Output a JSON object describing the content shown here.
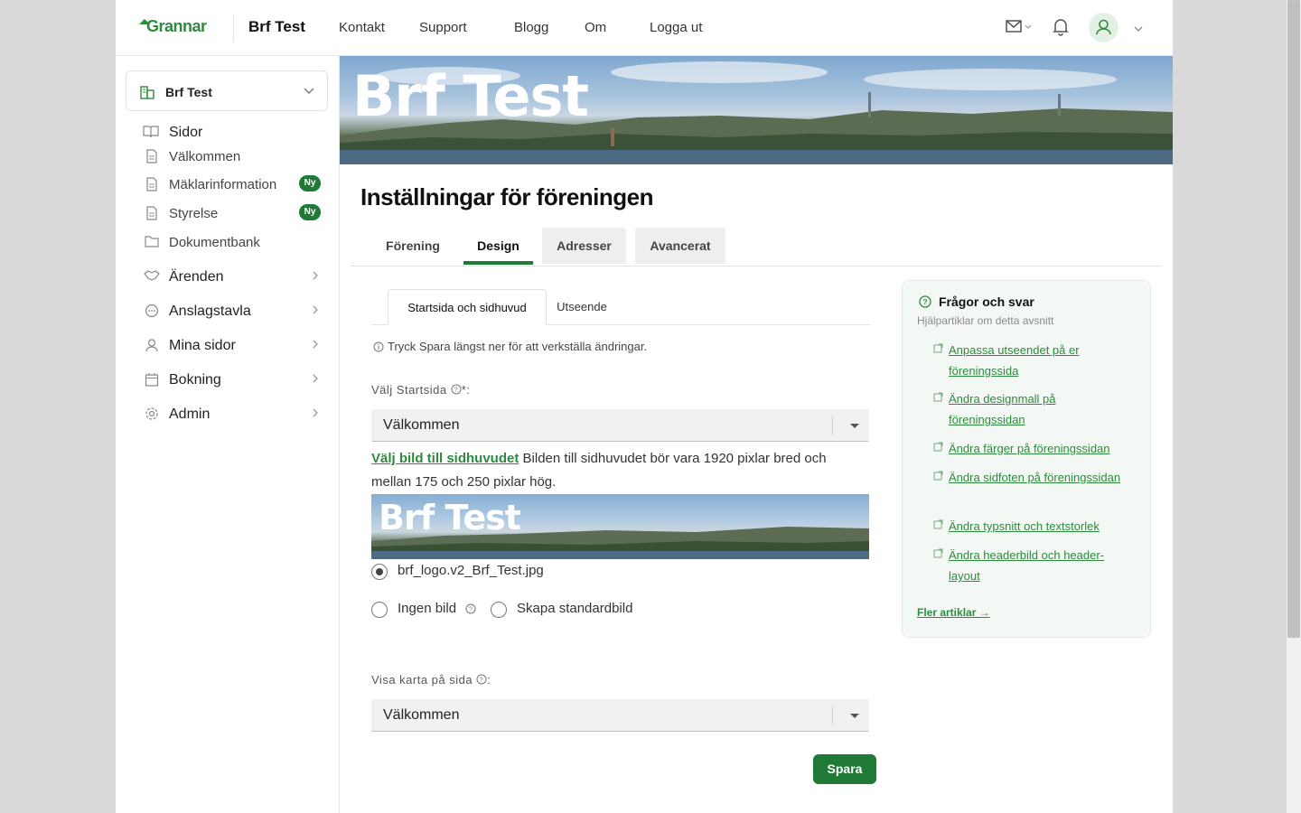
{
  "header": {
    "logo": "Grannar",
    "site_name": "Brf Test",
    "nav": [
      "Kontakt",
      "Support",
      "Blogg",
      "Om",
      "Logga ut"
    ]
  },
  "sidebar": {
    "org_select": "Brf Test",
    "items": [
      {
        "label": "Sidor",
        "icon": "book-icon",
        "type": "section"
      },
      {
        "label": "Välkommen",
        "icon": "document-icon",
        "type": "sub"
      },
      {
        "label": "Mäklarinformation",
        "icon": "document-icon",
        "type": "sub",
        "badge": "Ny"
      },
      {
        "label": "Styrelse",
        "icon": "document-icon",
        "type": "sub",
        "badge": "Ny"
      },
      {
        "label": "Dokumentbank",
        "icon": "folder-icon",
        "type": "sub"
      },
      {
        "label": "Ärenden",
        "icon": "handshake-icon",
        "type": "section"
      },
      {
        "label": "Anslagstavla",
        "icon": "chat-icon",
        "type": "section"
      },
      {
        "label": "Mina sidor",
        "icon": "user-icon",
        "type": "section"
      },
      {
        "label": "Bokning",
        "icon": "calendar-icon",
        "type": "section"
      },
      {
        "label": "Admin",
        "icon": "gear-icon",
        "type": "section"
      }
    ]
  },
  "banner": {
    "title": "Brf Test"
  },
  "main": {
    "title": "Inställningar för föreningen",
    "tabs": [
      "Förening",
      "Design",
      "Adresser",
      "Avancerat"
    ],
    "active_tab": "Design",
    "subtabs": [
      "Startsida och sidhuvud",
      "Utseende"
    ],
    "active_subtab": "Startsida och sidhuvud",
    "info": "Tryck Spara längst ner för att verkställa ändringar.",
    "startpage": {
      "label": "Välj Startsida",
      "required": "*:",
      "value": "Välkommen"
    },
    "header_image": {
      "link": "Välj bild till sidhuvudet",
      "desc": "Bilden till sidhuvudet bör vara 1920 pixlar bred och mellan 175 och 250 pixlar hög.",
      "thumb_title": "Brf Test",
      "options": [
        {
          "label": "brf_logo.v2_Brf_Test.jpg",
          "checked": true
        },
        {
          "label": "Ingen bild",
          "checked": false
        },
        {
          "label": "Skapa standardbild",
          "checked": false
        }
      ]
    },
    "map": {
      "label": "Visa karta på sida",
      "suffix": ":",
      "value": "Välkommen"
    },
    "save": "Spara"
  },
  "help": {
    "title": "Frågor och svar",
    "subtitle": "Hjälpartiklar om detta avsnitt",
    "links": [
      "Anpassa utseendet på er föreningssida",
      "Ändra designmall på föreningssidan",
      "Ändra färger på föreningssidan",
      "Ändra sidfoten på föreningssidan",
      "Ändra typsnitt och textstorlek",
      "Ändra headerbild och header-layout"
    ],
    "more": "Fler artiklar →"
  },
  "colors": {
    "brand": "#1e7a35",
    "link": "#2d8a3e"
  }
}
